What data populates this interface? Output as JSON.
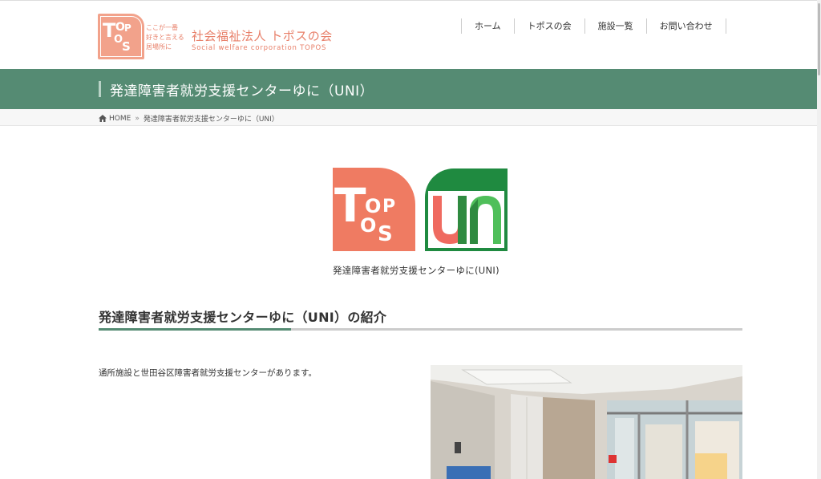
{
  "header": {
    "logo_letters": [
      "T",
      "O",
      "P",
      "O",
      "S"
    ],
    "tagline": [
      "ここが一番",
      "好きと言える",
      "居場所に"
    ],
    "org_name": "社会福祉法人 トポスの会",
    "org_sub": "Social welfare corporation TOPOS"
  },
  "nav": {
    "items": [
      {
        "label": "ホーム"
      },
      {
        "label": "トポスの会"
      },
      {
        "label": "施設一覧"
      },
      {
        "label": "お問い合わせ"
      }
    ]
  },
  "page_title": "発達障害者就労支援センターゆに（UNI）",
  "breadcrumb": {
    "home": "HOME",
    "separator": "»",
    "current": "発達障害者就労支援センターゆに（UNI）"
  },
  "main_logo": {
    "caption": "発達障害者就労支援センターゆに(UNI)"
  },
  "section": {
    "title": "発達障害者就労支援センターゆに（UNI）の紹介",
    "intro": "通所施設と世田谷区障害者就労支援センターがあります。"
  },
  "colors": {
    "brand_green": "#558b73",
    "brand_orange": "#ef7b62",
    "uni_green": "#1f8a40",
    "uni_red": "#ef6a60",
    "uni_lightgreen": "#4fbf5a"
  }
}
